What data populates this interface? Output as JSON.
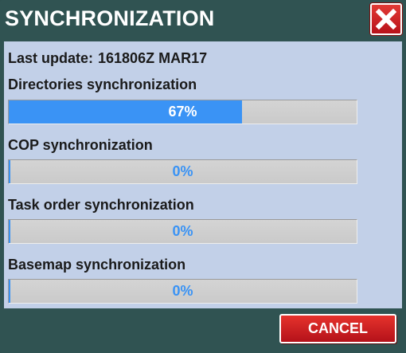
{
  "title": "SYNCHRONIZATION",
  "close_icon": "close-x-icon",
  "last_update": {
    "label": "Last update:",
    "value": "161806Z MAR17"
  },
  "sections": [
    {
      "label": "Directories synchronization",
      "progress_text": "67%",
      "progress": 0.67
    },
    {
      "label": "COP synchronization",
      "progress_text": "0%",
      "progress": 0
    },
    {
      "label": "Task order synchronization",
      "progress_text": "0%",
      "progress": 0
    },
    {
      "label": "Basemap synchronization",
      "progress_text": "0%",
      "progress": 0
    }
  ],
  "cancel_label": "CANCEL",
  "colors": {
    "frame": "#305352",
    "panel": "#c2d0e8",
    "progress_fill": "#3a93f5",
    "progress_text_on_fill": "#ffffff",
    "progress_text_empty": "#3a93f5",
    "button_red": "#d02028"
  }
}
